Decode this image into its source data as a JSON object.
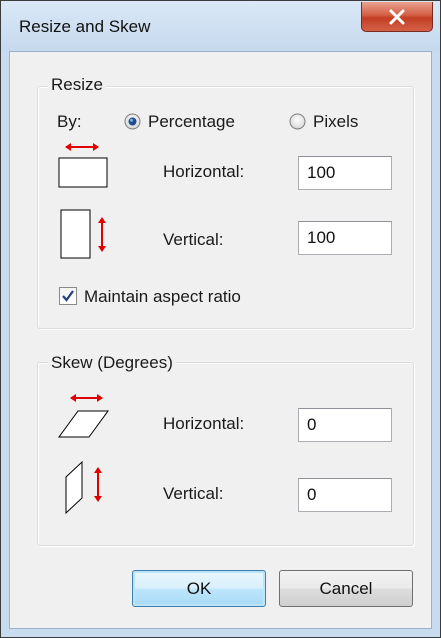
{
  "window": {
    "title": "Resize and Skew",
    "close_label": "×"
  },
  "resize": {
    "group_label": "Resize",
    "by_label": "By:",
    "options": [
      "Percentage",
      "Pixels"
    ],
    "selected": "Percentage",
    "horizontal_label": "Horizontal:",
    "horizontal_value": "100",
    "vertical_label": "Vertical:",
    "vertical_value": "100",
    "maintain_aspect_label": "Maintain aspect ratio",
    "maintain_aspect_checked": true
  },
  "skew": {
    "group_label": "Skew (Degrees)",
    "horizontal_label": "Horizontal:",
    "horizontal_value": "0",
    "vertical_label": "Vertical:",
    "vertical_value": "0"
  },
  "buttons": {
    "ok": "OK",
    "cancel": "Cancel"
  },
  "colors": {
    "arrow": "#e00000",
    "default_button_border": "#3c7fb1",
    "close_button": "#c7452a"
  },
  "icons": {
    "resize_horizontal": "resize-horizontal-icon",
    "resize_vertical": "resize-vertical-icon",
    "skew_horizontal": "skew-horizontal-icon",
    "skew_vertical": "skew-vertical-icon"
  }
}
